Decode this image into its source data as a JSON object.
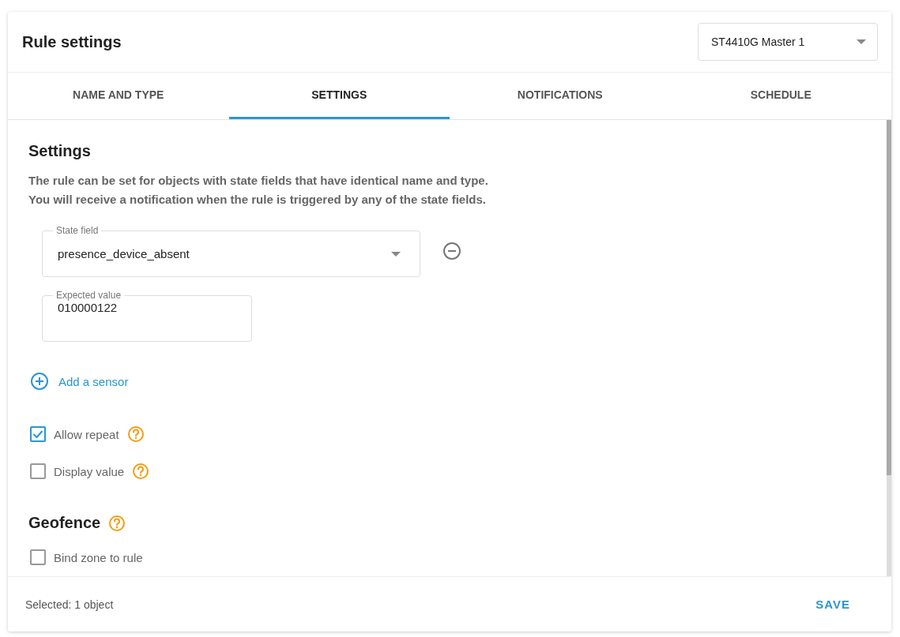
{
  "dialog": {
    "title": "Rule settings",
    "device_select": {
      "value": "ST4410G Master 1"
    }
  },
  "tabs": [
    {
      "label": "NAME AND TYPE",
      "selected": false
    },
    {
      "label": "SETTINGS",
      "selected": true
    },
    {
      "label": "NOTIFICATIONS",
      "selected": false
    },
    {
      "label": "SCHEDULE",
      "selected": false
    }
  ],
  "settings": {
    "heading": "Settings",
    "description_lines": [
      "The rule can be set for objects with state fields that have identical name and type.",
      "You will receive a notification when the rule is triggered by any of the state fields."
    ],
    "state_field": {
      "label": "State field",
      "value": "presence_device_absent"
    },
    "expected_value": {
      "label": "Expected value",
      "value": "010000122"
    },
    "add_sensor": "Add a sensor",
    "options": [
      {
        "label": "Allow repeat",
        "checked": true
      },
      {
        "label": "Display value",
        "checked": false
      }
    ]
  },
  "geofence": {
    "heading": "Geofence",
    "options": [
      {
        "label": "Bind zone to rule",
        "checked": false
      }
    ]
  },
  "footer": {
    "selection": "Selected: 1 object",
    "save": "SAVE"
  }
}
